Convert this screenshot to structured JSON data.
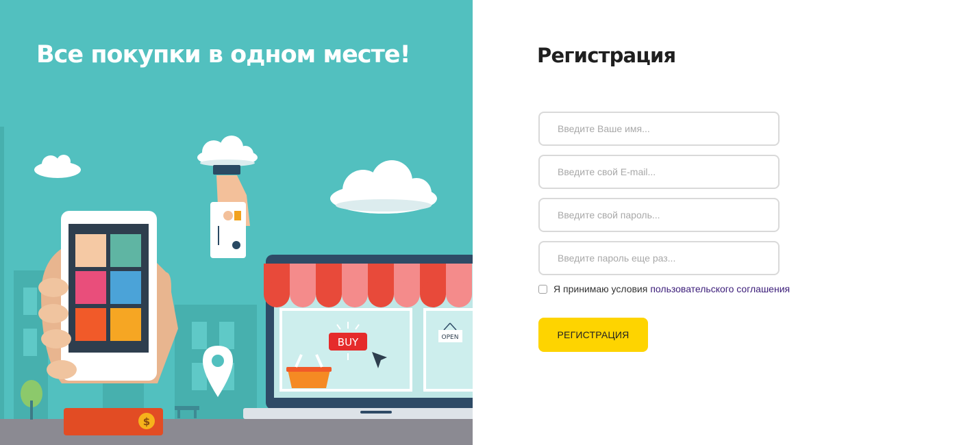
{
  "hero": {
    "title": "Все покупки в одном месте!",
    "illustration": {
      "buy_label": "BUY",
      "open_label": "OPEN",
      "coin_symbol": "$"
    }
  },
  "form": {
    "title": "Регистрация",
    "fields": [
      {
        "placeholder": "Введите Ваше имя..."
      },
      {
        "placeholder": "Введите свой E-mail..."
      },
      {
        "placeholder": "Введите свой пароль..."
      },
      {
        "placeholder": "Введите пароль еще раз..."
      }
    ],
    "agreement": {
      "text": "Я принимаю условия",
      "link": "пользовательского соглашения",
      "checked": false
    },
    "submit_label": "РЕГИСТРАЦИЯ"
  },
  "colors": {
    "hero_bg": "#52c0bf",
    "accent_button": "#fed400",
    "link": "#3a1b78",
    "title": "#1f1f1f"
  }
}
